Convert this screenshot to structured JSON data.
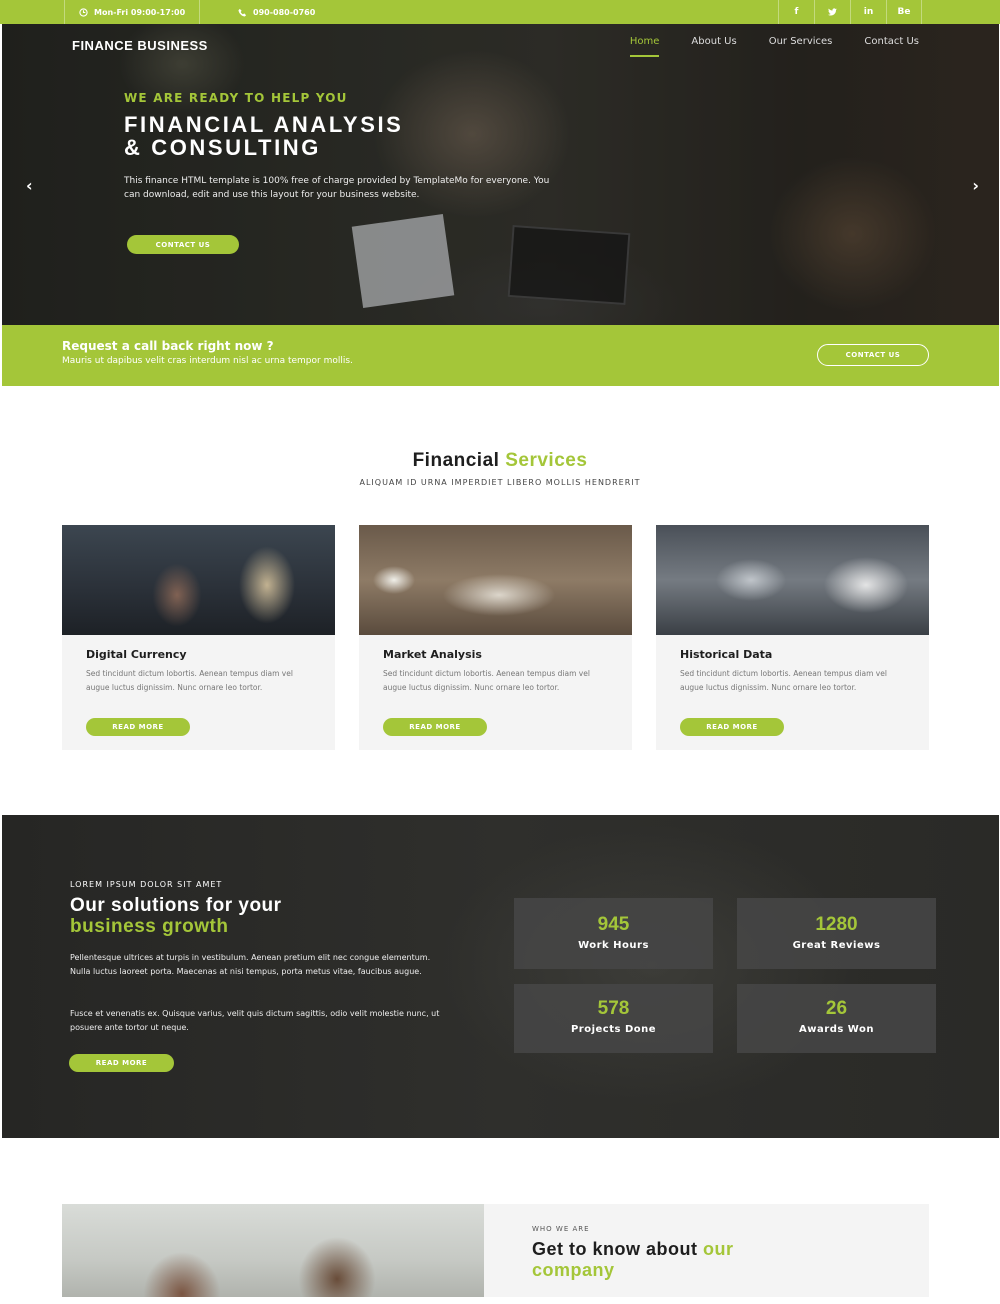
{
  "topbar": {
    "hours": "Mon-Fri 09:00-17:00",
    "phone": "090-080-0760",
    "social": [
      "f",
      "t",
      "in",
      "Be"
    ]
  },
  "brand": "FINANCE BUSINESS",
  "nav": {
    "items": [
      "Home",
      "About Us",
      "Our Services",
      "Contact Us"
    ],
    "active": "Home"
  },
  "hero": {
    "eyebrow": "WE ARE READY TO HELP YOU",
    "title_line1": "FINANCIAL ANALYSIS",
    "title_line2": "& CONSULTING",
    "description": "This finance HTML template is 100% free of charge provided by TemplateMo for everyone. You can download, edit and use this layout for your business website.",
    "cta": "CONTACT US",
    "prev": "‹",
    "next": "›"
  },
  "callback": {
    "title": "Request a call back right now ?",
    "subtitle": "Mauris ut dapibus velit cras interdum nisl ac urna tempor mollis.",
    "button": "CONTACT US"
  },
  "services": {
    "title_main": "Financial",
    "title_accent": "Services",
    "subtitle": "ALIQUAM ID URNA IMPERDIET LIBERO MOLLIS HENDRERIT",
    "cards": [
      {
        "title": "Digital Currency",
        "text": "Sed tincidunt dictum lobortis. Aenean tempus diam vel augue luctus dignissim. Nunc ornare leo tortor.",
        "button": "READ MORE"
      },
      {
        "title": "Market Analysis",
        "text": "Sed tincidunt dictum lobortis. Aenean tempus diam vel augue luctus dignissim. Nunc ornare leo tortor.",
        "button": "READ MORE"
      },
      {
        "title": "Historical Data",
        "text": "Sed tincidunt dictum lobortis. Aenean tempus diam vel augue luctus dignissim. Nunc ornare leo tortor.",
        "button": "READ MORE"
      }
    ]
  },
  "solutions": {
    "eyebrow": "LOREM IPSUM DOLOR SIT AMET",
    "title_line1": "Our solutions for your",
    "title_accent": "business growth",
    "paragraph1": "Pellentesque ultrices at turpis in vestibulum. Aenean pretium elit nec congue elementum. Nulla luctus laoreet porta. Maecenas at nisi tempus, porta metus vitae, faucibus augue.",
    "paragraph2": "Fusce et venenatis ex. Quisque varius, velit quis dictum sagittis, odio velit molestie nunc, ut posuere ante tortor ut neque.",
    "button": "READ MORE",
    "stats": [
      {
        "value": "945",
        "label": "Work Hours"
      },
      {
        "value": "1280",
        "label": "Great Reviews"
      },
      {
        "value": "578",
        "label": "Projects Done"
      },
      {
        "value": "26",
        "label": "Awards Won"
      }
    ]
  },
  "about": {
    "eyebrow": "WHO WE ARE",
    "title_main": "Get to know about",
    "title_accent1": "our",
    "title_accent2": "company"
  },
  "colors": {
    "accent": "#a4c639",
    "dark": "#2b2b29",
    "card_bg": "#f4f4f4"
  }
}
